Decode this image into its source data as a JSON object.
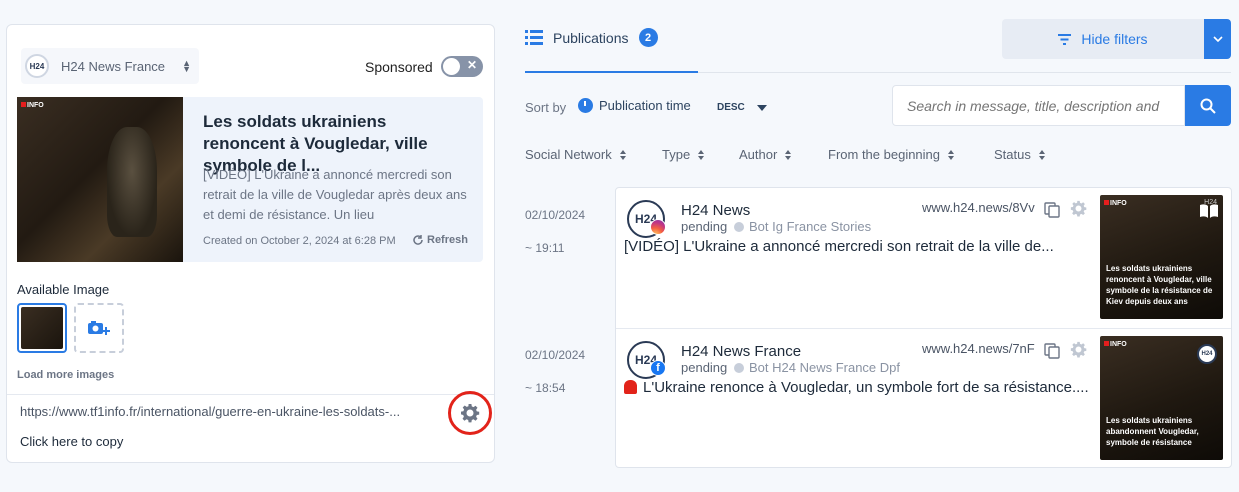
{
  "left": {
    "account_name": "H24 News France",
    "account_avatar": "H24",
    "sponsored_label": "Sponsored",
    "sponsored_on": false,
    "preview": {
      "source_logo": "INFO",
      "title": "Les soldats ukrainiens renoncent à Vougledar, ville symbole de l...",
      "description": "[VIDÉO] L'Ukraine a annoncé mercredi son retrait de la ville de Vougledar après deux ans et demi de résistance. Un lieu",
      "created": "Created on October 2, 2024 at 6:28 PM",
      "refresh_label": "Refresh"
    },
    "available_image_label": "Available Image",
    "load_more_label": "Load more images",
    "url": "https://www.tf1info.fr/international/guerre-en-ukraine-les-soldats-...",
    "copy_label": "Click here to copy"
  },
  "header": {
    "tab_label": "Publications",
    "tab_count": "2",
    "hide_filters_label": "Hide filters"
  },
  "sort": {
    "label": "Sort by",
    "field": "Publication time",
    "direction": "DESC"
  },
  "search": {
    "placeholder": "Search in message, title, description and"
  },
  "filters": [
    "Social Network",
    "Type",
    "Author",
    "From the beginning",
    "Status"
  ],
  "posts": [
    {
      "date": "02/10/2024",
      "time": "~ 19:11",
      "author": "H24 News",
      "avatar": "H24",
      "network": "instagram-icon",
      "status": "pending",
      "bot": "Bot Ig France Stories",
      "link": "www.h24.news/8Vv",
      "message": "[VIDÉO] L'Ukraine a annoncé mercredi son retrait de la ville de...",
      "thumb_caption": "Les soldats ukrainiens renoncent à Vougledar, ville symbole de la résistance de Kiev depuis deux ans",
      "thumb_logo": "INFO",
      "thumb_brand": "H24"
    },
    {
      "date": "02/10/2024",
      "time": "~ 18:54",
      "author": "H24 News France",
      "avatar": "H24",
      "network": "facebook-icon",
      "status": "pending",
      "bot": "Bot H24 News France Dpf",
      "link": "www.h24.news/7nF",
      "message": "L'Ukraine renonce à Vougledar, un symbole fort de sa résistance....",
      "thumb_caption": "Les soldats ukrainiens abandonnent Vougledar, symbole de résistance",
      "thumb_logo": "INFO",
      "thumb_brand": "H24"
    }
  ],
  "colors": {
    "accent": "#2a7be4",
    "highlight_ring": "#e2231a"
  }
}
